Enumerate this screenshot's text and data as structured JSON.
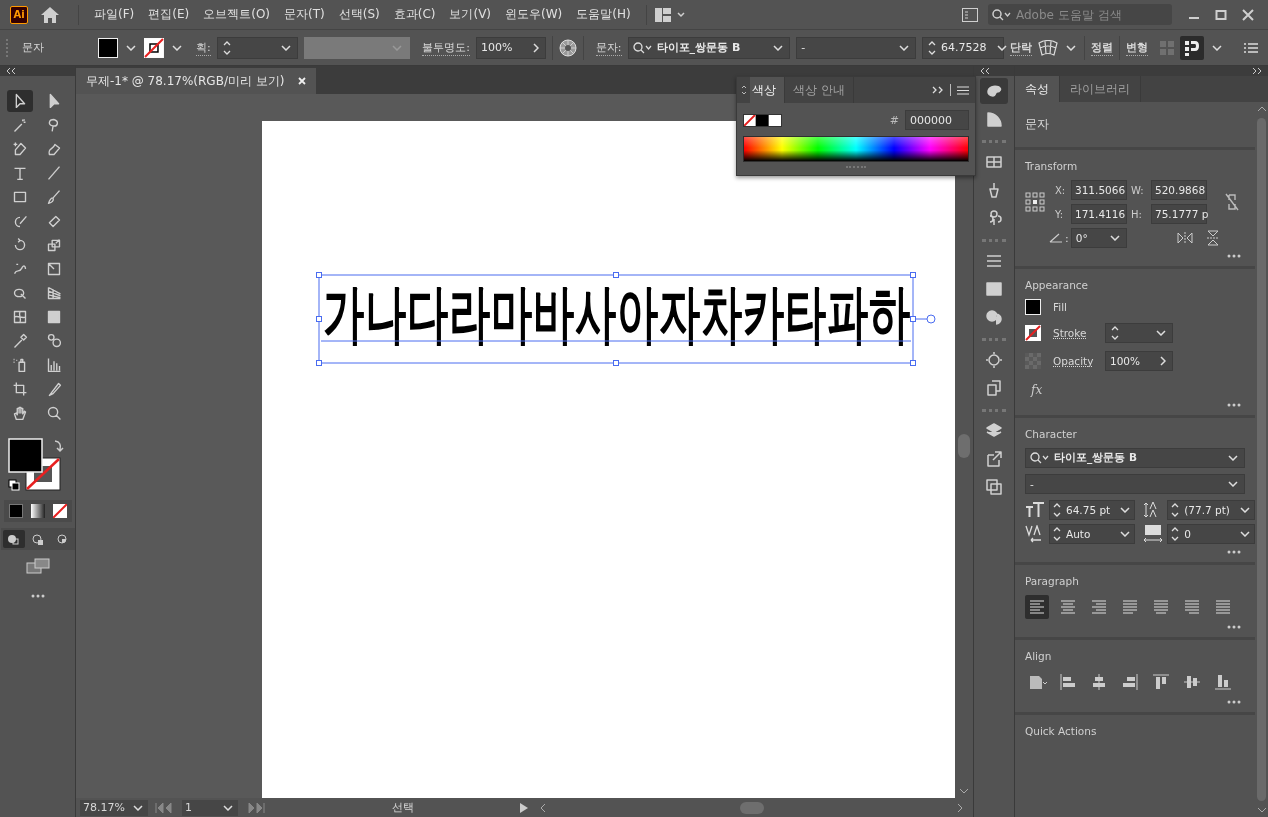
{
  "app_logo": "Ai",
  "menu": [
    "파일(F)",
    "편집(E)",
    "오브젝트(O)",
    "문자(T)",
    "선택(S)",
    "효과(C)",
    "보기(V)",
    "윈도우(W)",
    "도움말(H)"
  ],
  "help_search": {
    "placeholder": "Adobe 도움말 검색"
  },
  "control_bar": {
    "object_type": "문자",
    "stroke_label": "획:",
    "opacity_label": "불투명도:",
    "opacity": "100%",
    "font_label": "문자:",
    "font": "타이포_쌍문동 B",
    "style": "-",
    "size": "64.7528",
    "paragraph_link": "단락",
    "align_link": "정렬",
    "transform_link": "변형"
  },
  "document_tab": {
    "title": "무제-1* @ 78.17%(RGB/미리 보기)"
  },
  "tools": [
    {
      "kind": "selection",
      "selected": true
    },
    {
      "kind": "direct-selection",
      "selected": false
    },
    {
      "kind": "magic-wand",
      "selected": false
    },
    {
      "kind": "lasso",
      "selected": false
    },
    {
      "kind": "pen",
      "selected": false
    },
    {
      "kind": "curvature",
      "selected": false
    },
    {
      "kind": "type",
      "selected": false
    },
    {
      "kind": "line",
      "selected": false
    },
    {
      "kind": "rectangle",
      "selected": false
    },
    {
      "kind": "paintbrush",
      "selected": false
    },
    {
      "kind": "shaper",
      "selected": false
    },
    {
      "kind": "eraser",
      "selected": false
    },
    {
      "kind": "rotate",
      "selected": false
    },
    {
      "kind": "scale",
      "selected": false
    },
    {
      "kind": "puppet-warp",
      "selected": false
    },
    {
      "kind": "free-transform",
      "selected": false
    },
    {
      "kind": "shape-builder",
      "selected": false
    },
    {
      "kind": "perspective-grid",
      "selected": false
    },
    {
      "kind": "mesh",
      "selected": false
    },
    {
      "kind": "gradient",
      "selected": false
    },
    {
      "kind": "eyedropper",
      "selected": false
    },
    {
      "kind": "blend",
      "selected": false
    },
    {
      "kind": "symbol-sprayer",
      "selected": false
    },
    {
      "kind": "column-graph",
      "selected": false
    },
    {
      "kind": "artboard",
      "selected": false
    },
    {
      "kind": "slice",
      "selected": false
    },
    {
      "kind": "hand",
      "selected": false
    },
    {
      "kind": "zoom",
      "selected": false
    }
  ],
  "draw_modes": [
    {
      "kind": "normal",
      "selected": true
    },
    {
      "kind": "behind",
      "selected": false
    },
    {
      "kind": "inside",
      "selected": false
    }
  ],
  "color_panel": {
    "tabs": [
      {
        "label": "색상",
        "selected": true
      },
      {
        "label": "색상 안내",
        "selected": false
      }
    ],
    "hash": "#",
    "hex": "000000"
  },
  "dock": [
    {
      "kind": "color",
      "selected": true
    },
    {
      "kind": "color-guide",
      "selected": false
    },
    {
      "kind": "swatches",
      "selected": false
    },
    {
      "kind": "brushes",
      "selected": false
    },
    {
      "kind": "symbols",
      "selected": false
    },
    {
      "kind": "stroke",
      "selected": false
    },
    {
      "kind": "gradient",
      "selected": false
    },
    {
      "kind": "transparency",
      "selected": false
    },
    {
      "kind": "appearance",
      "selected": false
    },
    {
      "kind": "graphic-styles",
      "selected": false
    },
    {
      "kind": "layers",
      "selected": false
    },
    {
      "kind": "asset-export",
      "selected": false
    },
    {
      "kind": "artboards",
      "selected": false
    }
  ],
  "artboard_text": "가나다라마바사아자차카타파하",
  "properties": {
    "tabs": [
      {
        "label": "속성",
        "selected": true
      },
      {
        "label": "라이브러리",
        "selected": false
      }
    ],
    "object_type": "문자",
    "transform": {
      "title": "Transform",
      "fields": [
        {
          "label": "X:",
          "value": "311.5066"
        },
        {
          "label": "W:",
          "value": "520.9868"
        },
        {
          "label": "Y:",
          "value": "171.4116"
        },
        {
          "label": "H:",
          "value": "75.1777 p"
        }
      ],
      "angle_label": ":",
      "angle": "0°"
    },
    "appearance": {
      "title": "Appearance",
      "fill_label": "Fill",
      "stroke_label": "Stroke",
      "opacity_label": "Opacity",
      "opacity": "100%",
      "effects": "fx"
    },
    "character": {
      "title": "Character",
      "font": "타이포_쌍문동 B",
      "style": "-",
      "size": "64.75 pt",
      "leading": "(77.7 pt)",
      "kerning": "Auto",
      "tracking": "0"
    },
    "paragraph": {
      "title": "Paragraph",
      "alignments": [
        {
          "kind": "left",
          "selected": true
        },
        {
          "kind": "center",
          "selected": false
        },
        {
          "kind": "right",
          "selected": false
        },
        {
          "kind": "justify-left",
          "selected": false
        },
        {
          "kind": "justify-center",
          "selected": false
        },
        {
          "kind": "justify-right",
          "selected": false
        },
        {
          "kind": "justify-all",
          "selected": false
        }
      ]
    },
    "align": {
      "title": "Align"
    },
    "quick_actions": {
      "title": "Quick Actions"
    }
  },
  "status_bar": {
    "zoom": "78.17%",
    "page": "1",
    "tool": "선택"
  }
}
